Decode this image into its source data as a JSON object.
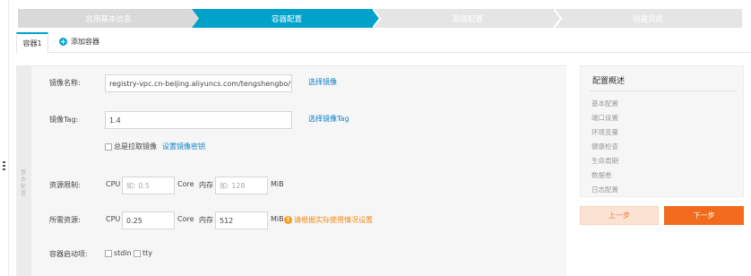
{
  "steps": [
    {
      "label": "应用基本信息",
      "state": "done"
    },
    {
      "label": "容器配置",
      "state": "active"
    },
    {
      "label": "高级配置",
      "state": "todo"
    },
    {
      "label": "创建完成",
      "state": "todo"
    }
  ],
  "colors": {
    "step_done": "#d9d9d9",
    "step_active": "#00a2ca",
    "step_todo": "#e5e5e5",
    "accent": "#f26a1b",
    "link": "#0a7fc7",
    "warn": "#f08b12"
  },
  "tabs": {
    "container_tab": "容器1",
    "add_label": "添加容器",
    "add_icon": "plus-circle-icon"
  },
  "side_label": "基本配置",
  "form": {
    "image_name_label": "镜像名称:",
    "image_name_value": "registry-vpc.cn-beijing.aliyuncs.com/tengshengbo/yunpan",
    "select_image": "选择镜像",
    "image_tag_label": "镜像Tag:",
    "image_tag_value": "1.4",
    "select_tag": "选择镜像Tag",
    "always_pull": "总是拉取镜像",
    "set_secret": "设置镜像密钥",
    "limit_label": "资源限制:",
    "cpu": "CPU",
    "cpu_limit_placeholder": "如: 0.5",
    "core": "Core",
    "memory": "内存",
    "mem_limit_placeholder": "如: 128",
    "mib": "MiB",
    "request_label": "所需资源:",
    "cpu_request": "0.25",
    "mem_request": "512",
    "warn_text": "请根据实际使用情况设置",
    "startup_label": "容器启动项:",
    "stdin": "stdin",
    "tty": "tty"
  },
  "summary": {
    "title": "配置概述",
    "items": [
      "基本配置",
      "端口设置",
      "环境变量",
      "健康检查",
      "生命周期",
      "数据卷",
      "日志配置"
    ]
  },
  "buttons": {
    "prev": "上一步",
    "next": "下一步"
  }
}
